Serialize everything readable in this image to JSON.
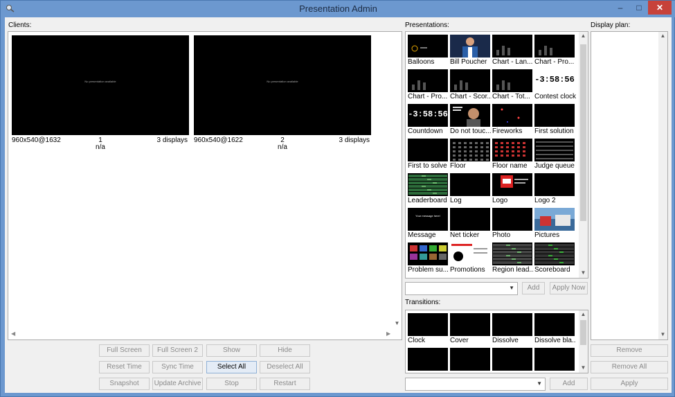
{
  "window": {
    "title": "Presentation Admin",
    "min": "–",
    "max": "□",
    "close": "✕",
    "app_icon": "magnifier-icon"
  },
  "clients": {
    "label": "Clients:",
    "items": [
      {
        "resolution": "960x540@1632",
        "number": "1",
        "status": "n/a",
        "displays": "3 displays",
        "screen_text": "No presentation available"
      },
      {
        "resolution": "960x540@1622",
        "number": "2",
        "status": "n/a",
        "displays": "3 displays",
        "screen_text": "No presentation available"
      }
    ],
    "buttons": {
      "full_screen": "Full Screen",
      "full_screen_2": "Full Screen 2",
      "show": "Show",
      "hide": "Hide",
      "reset_time": "Reset Time",
      "sync_time": "Sync Time",
      "select_all": "Select All",
      "deselect_all": "Deselect All",
      "snapshot": "Snapshot",
      "update_archive": "Update Archive",
      "stop": "Stop",
      "restart": "Restart"
    }
  },
  "presentations": {
    "label": "Presentations:",
    "items": [
      "Balloons",
      "Bill Poucher",
      "Chart - Lan...",
      "Chart - Pro...",
      "Chart - Pro...",
      "Chart - Scor...",
      "Chart - Tot...",
      "Contest clock",
      "Countdown",
      "Do not touc...",
      "Fireworks",
      "First solution",
      "First to solve",
      "Floor",
      "Floor name",
      "Judge queue",
      "Leaderboard",
      "Log",
      "Logo",
      "Logo 2",
      "Message",
      "Net ticker",
      "Photo",
      "Pictures",
      "Problem su...",
      "Promotions",
      "Region lead...",
      "Scoreboard"
    ],
    "clock_text": "-3:58:56",
    "message_text": "Your message here!",
    "add": "Add",
    "apply_now": "Apply Now",
    "combo_value": ""
  },
  "transitions": {
    "label": "Transitions:",
    "items": [
      "Clock",
      "Cover",
      "Dissolve",
      "Dissolve bla..."
    ],
    "add": "Add",
    "combo_value": ""
  },
  "display_plan": {
    "label": "Display plan:",
    "remove": "Remove",
    "remove_all": "Remove All",
    "apply": "Apply"
  }
}
